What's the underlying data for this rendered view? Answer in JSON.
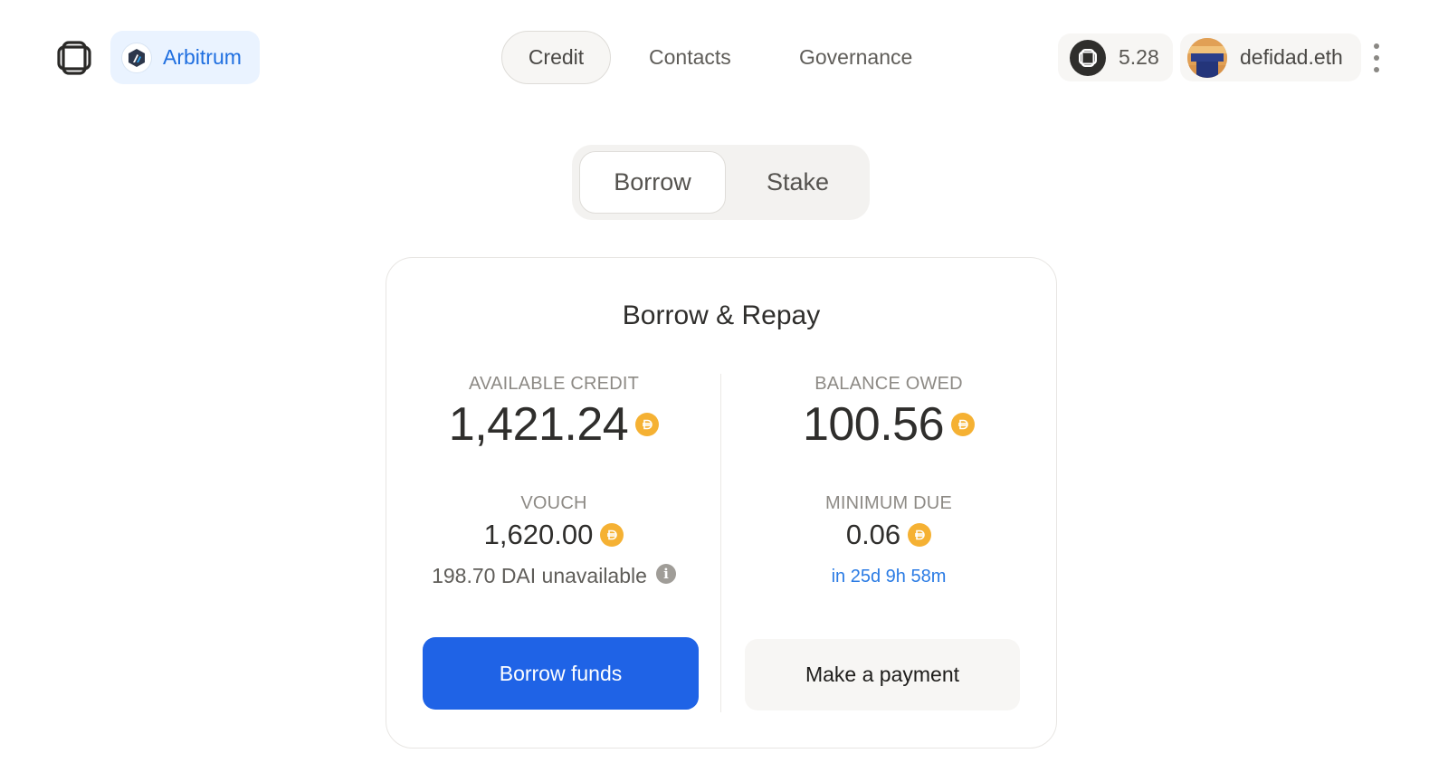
{
  "header": {
    "logo_icon": "union-logo-icon",
    "network": {
      "label": "Arbitrum",
      "icon": "arbitrum-icon",
      "color": "#1f6fe0"
    },
    "nav": [
      {
        "label": "Credit",
        "active": true
      },
      {
        "label": "Contacts",
        "active": false
      },
      {
        "label": "Governance",
        "active": false
      }
    ],
    "points": {
      "value": "5.28",
      "icon": "union-token-icon"
    },
    "account": {
      "name": "defidad.eth",
      "avatar": "avatar-image"
    },
    "menu_icon": "more-vertical-icon"
  },
  "mode_toggle": {
    "options": [
      {
        "label": "Borrow",
        "selected": true
      },
      {
        "label": "Stake",
        "selected": false
      }
    ]
  },
  "card": {
    "title": "Borrow & Repay",
    "left": {
      "available_credit_label": "AVAILABLE CREDIT",
      "available_credit_value": "1,421.24",
      "vouch_label": "VOUCH",
      "vouch_value": "1,620.00",
      "unavailable_text": "198.70 DAI unavailable",
      "button_label": "Borrow funds"
    },
    "right": {
      "balance_owed_label": "BALANCE OWED",
      "balance_owed_value": "100.56",
      "minimum_due_label": "MINIMUM DUE",
      "minimum_due_value": "0.06",
      "due_in_text": "in 25d 9h 58m",
      "button_label": "Make a payment"
    },
    "token_icon": "dai-icon"
  },
  "colors": {
    "primary_button": "#1f63e6",
    "dai_token": "#f5b133",
    "link_blue": "#2a7be4",
    "network_chip_bg": "#eaf3ff"
  }
}
